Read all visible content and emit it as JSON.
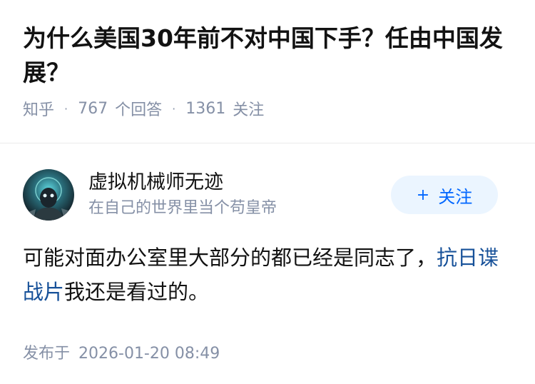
{
  "question": {
    "title": "为什么美国30年前不对中国下手？任由中国发展？",
    "source": "知乎",
    "answers_count": "767",
    "answers_label": "个回答",
    "followers_count": "1361",
    "followers_label": "关注"
  },
  "answer": {
    "author_name": "虚拟机械师无迹",
    "author_bio": "在自己的世界里当个苟皇帝",
    "follow_label": "关注",
    "text_before": "可能对面办公室里大部分的都已经是同志了，",
    "link_text": "抗日谍战片",
    "text_after": "我还是看过的。",
    "published_label": "发布于",
    "published_time": "2026-01-20 08:49"
  },
  "colors": {
    "accent": "#0066ff",
    "link": "#175199",
    "muted": "#8590a6",
    "follow_bg": "#ebf5ff"
  },
  "icons": {
    "follow": "plus-icon",
    "avatar": "avatar-image"
  }
}
